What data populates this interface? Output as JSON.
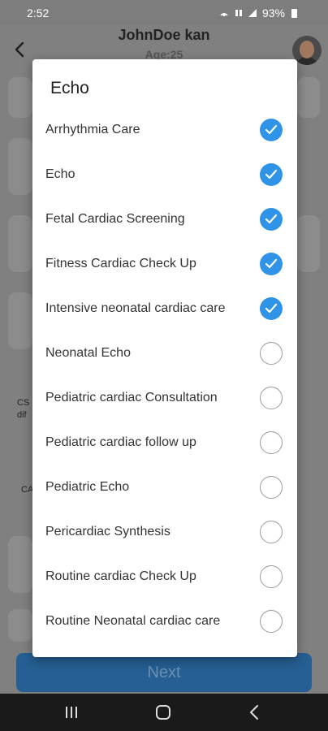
{
  "status_bar": {
    "time": "2:52",
    "battery": "93%"
  },
  "header": {
    "title": "JohnDoe kan",
    "subtitle": "Age:25"
  },
  "background_labels": {
    "left_1": "CS",
    "left_1b": "dif",
    "left_2": "CA"
  },
  "dialog": {
    "title": "Echo",
    "options": [
      {
        "label": "Arrhythmia Care",
        "checked": true
      },
      {
        "label": "Echo",
        "checked": true
      },
      {
        "label": "Fetal Cardiac Screening",
        "checked": true
      },
      {
        "label": "Fitness Cardiac Check Up",
        "checked": true
      },
      {
        "label": "Intensive neonatal cardiac care",
        "checked": true
      },
      {
        "label": "Neonatal Echo",
        "checked": false
      },
      {
        "label": "Pediatric cardiac Consultation",
        "checked": false
      },
      {
        "label": "Pediatric cardiac follow up",
        "checked": false
      },
      {
        "label": "Pediatric Echo",
        "checked": false
      },
      {
        "label": "Pericardiac  Synthesis",
        "checked": false
      },
      {
        "label": "Routine cardiac Check Up",
        "checked": false
      },
      {
        "label": "Routine Neonatal cardiac care",
        "checked": false
      }
    ]
  },
  "footer": {
    "next_label": "Next"
  },
  "colors": {
    "accent": "#2f93e8",
    "button": "#255f93",
    "scrim": "#808080"
  },
  "icons": {
    "back": "back-arrow-icon",
    "recents": "recents-icon",
    "home": "home-icon",
    "nav_back": "nav-back-icon"
  }
}
